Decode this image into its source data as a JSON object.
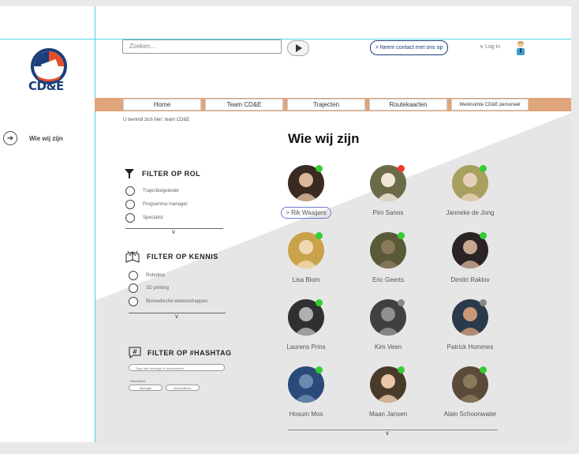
{
  "header": {
    "brand": "CD&E",
    "search_placeholder": "Zoeken...",
    "contact_label": "> Neem contact met ons op",
    "login_label": "Log in"
  },
  "sidebar": {
    "items": [
      {
        "label": "Wie wij zijn"
      }
    ]
  },
  "nav": {
    "items": [
      {
        "label": "Home"
      },
      {
        "label": "Team CD&E"
      },
      {
        "label": "Trajecten"
      },
      {
        "label": "Routekaarten"
      },
      {
        "label": "Werkruimte CD&E personeel"
      }
    ]
  },
  "breadcrumb": "U bevindt zich hier: team CD&E",
  "page_title": "Wie wij zijn",
  "filters": {
    "rol": {
      "title": "FILTER OP ROL",
      "options": [
        "Trajectbegeleider",
        "Programma manager",
        "Specialist"
      ]
    },
    "kennis": {
      "title": "FILTER OP KENNIS",
      "options": [
        "Robotica",
        "3D printing",
        "Biomedische wetenschappen"
      ]
    },
    "hashtag": {
      "title": "FILTER OP #HASHTAG",
      "placeholder": "Type hier #energie of #innovatieve",
      "results_label": "Resultaten:",
      "tags": [
        "#energie",
        "#innovatieve"
      ]
    }
  },
  "colors": {
    "online": "#33cc33",
    "busy": "#ee3b2b",
    "offline": "#888888",
    "nav_bg": "#e0a57b",
    "guide": "#4fd3e0"
  },
  "people": [
    {
      "name": "Rik Waaijers",
      "status": "online",
      "selected": true
    },
    {
      "name": "Pim Sanos",
      "status": "busy"
    },
    {
      "name": "Janneke de Jong",
      "status": "online"
    },
    {
      "name": "Lisa Blom",
      "status": "online"
    },
    {
      "name": "Eric Geerts",
      "status": "online"
    },
    {
      "name": "Dimitri Raklov",
      "status": "online"
    },
    {
      "name": "Laurens Prins",
      "status": "online"
    },
    {
      "name": "Kim Veen",
      "status": "offline"
    },
    {
      "name": "Patrick Hommes",
      "status": "offline"
    },
    {
      "name": "Hosum Mos",
      "status": "online"
    },
    {
      "name": "Maan Jansen",
      "status": "online"
    },
    {
      "name": "Alain Schoonwater",
      "status": "online"
    }
  ]
}
